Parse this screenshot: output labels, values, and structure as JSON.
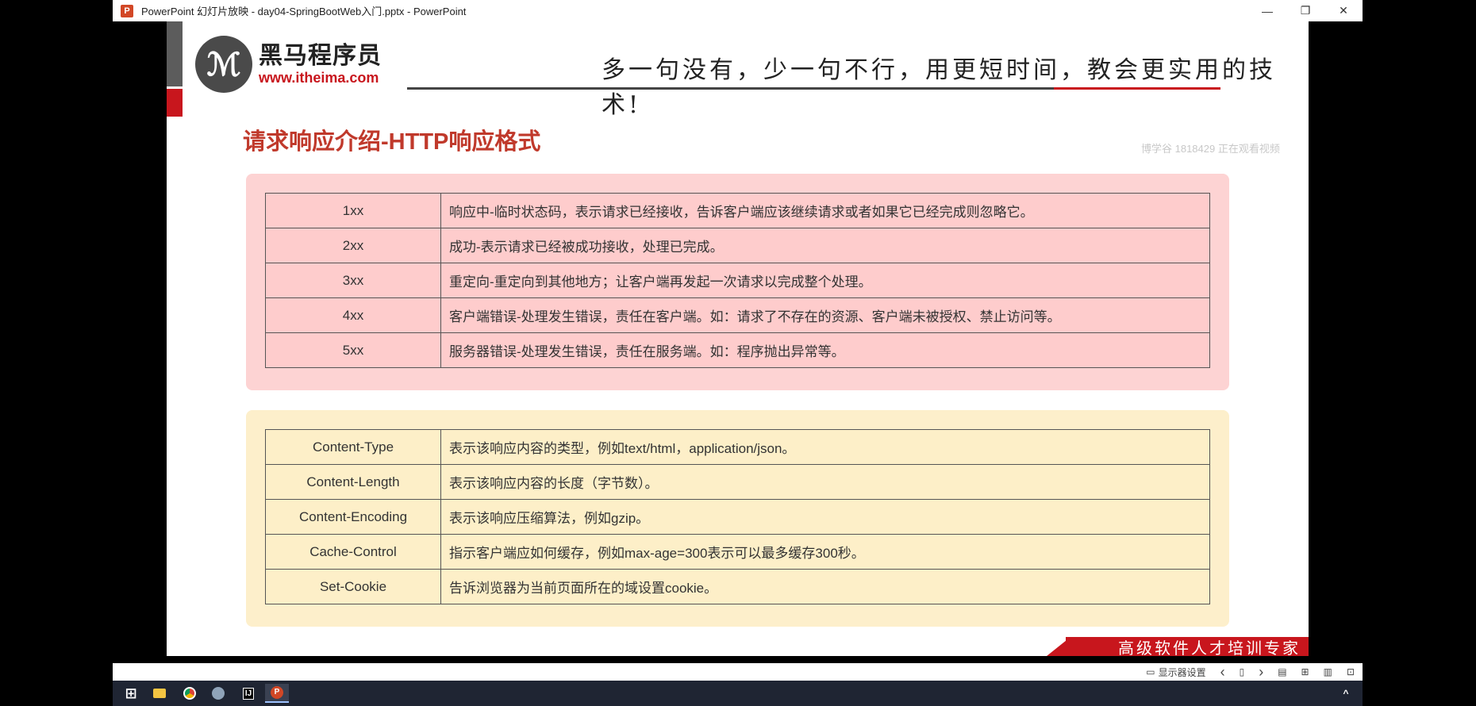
{
  "window": {
    "title": "PowerPoint 幻灯片放映  -  day04-SpringBootWeb入门.pptx - PowerPoint",
    "app_icon": "P",
    "minimize": "—",
    "restore": "❐",
    "close": "✕"
  },
  "slide": {
    "logo_glyph": "ℳ",
    "logo_cn": "黑马程序员",
    "logo_url": "www.itheima.com",
    "slogan": "多一句没有，少一句不行，用更短时间，教会更实用的技术!",
    "title": "请求响应介绍-HTTP响应格式",
    "watermark": "博学谷 1818429 正在观看视频",
    "status_codes": [
      {
        "code": "1xx",
        "desc": "响应中-临时状态码，表示请求已经接收，告诉客户端应该继续请求或者如果它已经完成则忽略它。"
      },
      {
        "code": "2xx",
        "desc": "成功-表示请求已经被成功接收，处理已完成。"
      },
      {
        "code": "3xx",
        "desc": "重定向-重定向到其他地方；让客户端再发起一次请求以完成整个处理。"
      },
      {
        "code": "4xx",
        "desc": "客户端错误-处理发生错误，责任在客户端。如：请求了不存在的资源、客户端未被授权、禁止访问等。"
      },
      {
        "code": "5xx",
        "desc": "服务器错误-处理发生错误，责任在服务端。如：程序抛出异常等。"
      }
    ],
    "headers": [
      {
        "name": "Content-Type",
        "desc": "表示该响应内容的类型，例如text/html，application/json。"
      },
      {
        "name": "Content-Length",
        "desc": "表示该响应内容的长度（字节数）。"
      },
      {
        "name": "Content-Encoding",
        "desc": "表示该响应压缩算法，例如gzip。"
      },
      {
        "name": "Cache-Control",
        "desc": "指示客户端应如何缓存，例如max-age=300表示可以最多缓存300秒。"
      },
      {
        "name": "Set-Cookie",
        "desc": "告诉浏览器为当前页面所在的域设置cookie。"
      }
    ],
    "banner": "高级软件人才培训专家"
  },
  "statusbar": {
    "display_settings": "显示器设置",
    "prev": "‹",
    "next": "›"
  },
  "taskbar": {
    "start": "⊞",
    "intellij": "IJ",
    "powerpoint": "P",
    "tray_chevron": "^"
  },
  "colors": {
    "accent_red": "#c8161d",
    "pink_panel": "#fdd3d3",
    "yellow_panel": "#fdefcb"
  }
}
